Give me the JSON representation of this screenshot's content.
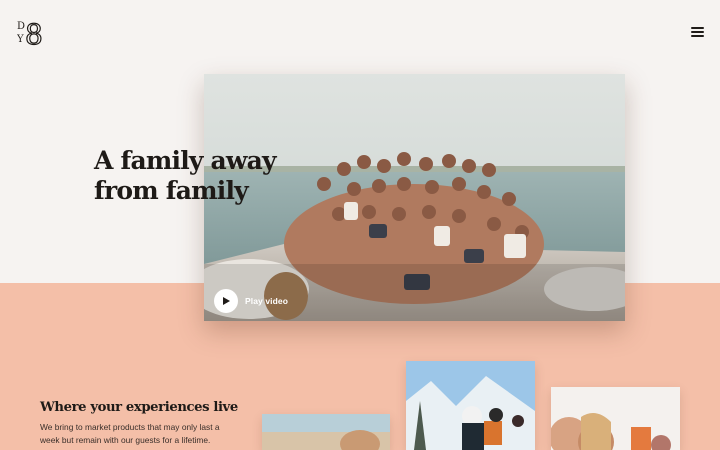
{
  "header": {
    "logo_icon": "brand-logo-icon",
    "menu_icon": "hamburger-menu-icon"
  },
  "hero": {
    "title_line1": "A family away",
    "title_line2": "from family",
    "photo_subject": "group-on-boat-photo",
    "play_label": "Play video",
    "play_icon": "play-icon"
  },
  "experiences": {
    "title": "Where your experiences live",
    "body": "We bring to market products that may only last a week but remain with our guests for a lifetime.",
    "thumbnails": [
      "beach-photo",
      "ski-photo",
      "selfie-photo"
    ]
  },
  "colors": {
    "background": "#f6f3f1",
    "band": "#f4bfa8",
    "text": "#1e1a17"
  }
}
